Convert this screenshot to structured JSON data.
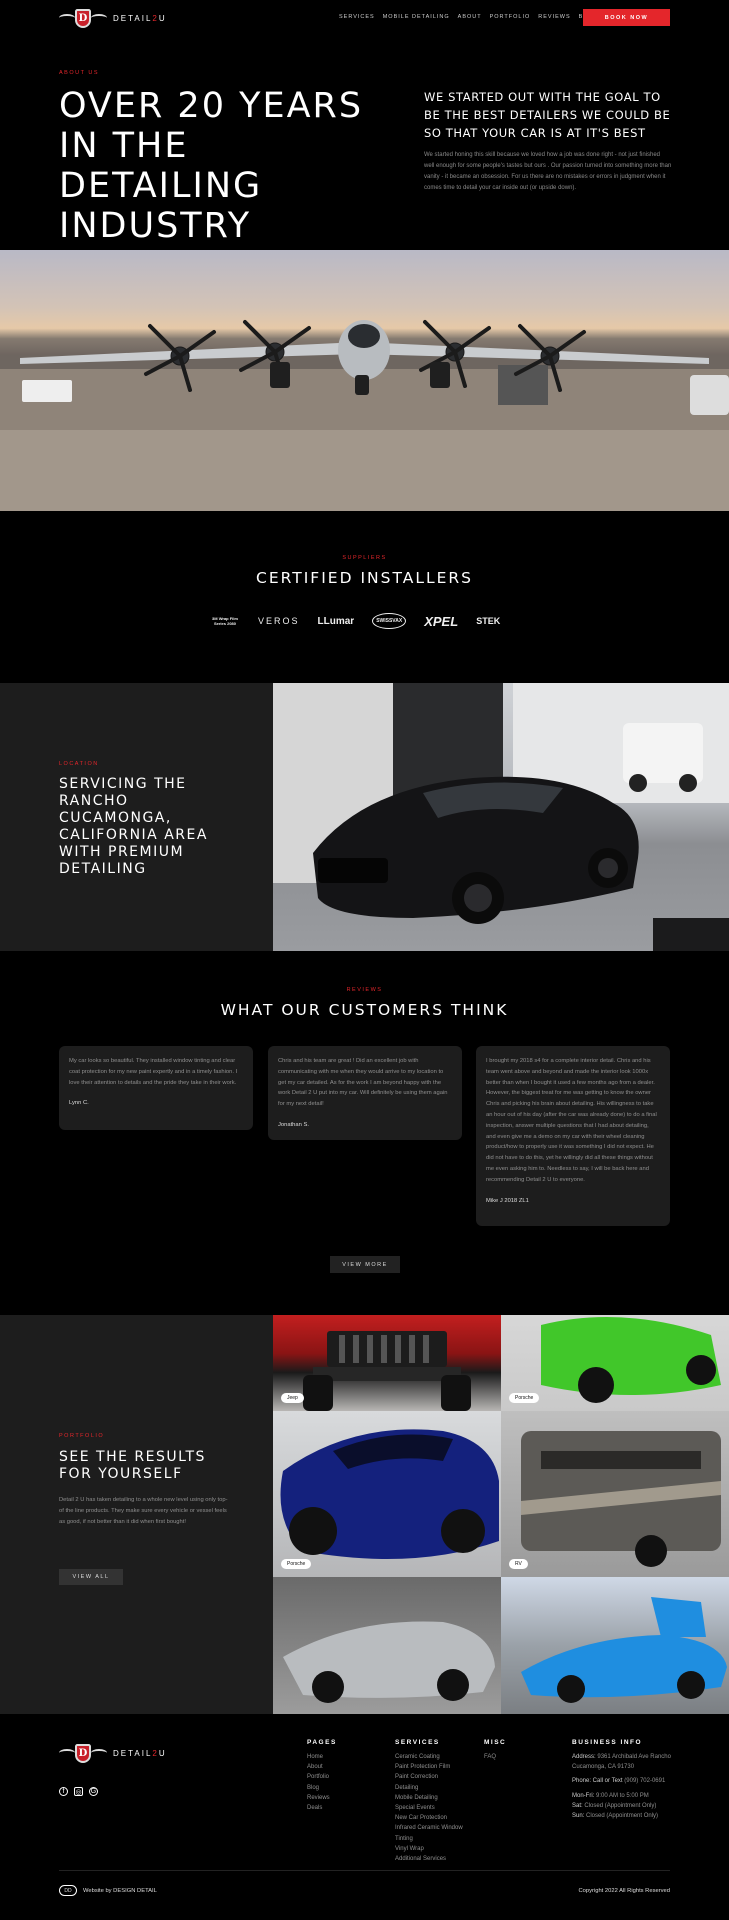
{
  "header": {
    "logo_text_a": "DETAIL",
    "logo_text_b": "2",
    "logo_text_c": "U",
    "logo_letter": "D",
    "nav": [
      "SERVICES",
      "MOBILE DETAILING",
      "ABOUT",
      "PORTFOLIO",
      "REVIEWS",
      "BLOG"
    ],
    "book_label": "BOOK NOW"
  },
  "about": {
    "eyebrow": "ABOUT US",
    "title": "OVER 20 YEARS IN THE DETAILING INDUSTRY",
    "subtitle": "WE STARTED OUT WITH THE GOAL TO BE THE BEST DETAILERS WE COULD BE SO THAT YOUR CAR IS AT IT'S BEST",
    "body": "We started honing this skill because we loved how a job was done right - not just finished well enough for some people's tastes but ours . Our passion turned into something more than vanity - it became an obsession. For us there are no mistakes or errors in judgment when it comes time to detail your car inside out (or upside down)."
  },
  "suppliers": {
    "eyebrow": "SUPPLIERS",
    "title": "CERTIFIED INSTALLERS",
    "logos": [
      "3M Wrap Film Series 2080",
      "VEROS",
      "LLumar",
      "SWISSVAX",
      "XPEL",
      "STEK"
    ]
  },
  "location": {
    "eyebrow": "LOCATION",
    "title": "SERVICING THE RANCHO CUCAMONGA, CALIFORNIA AREA WITH PREMIUM DETAILING"
  },
  "reviews": {
    "eyebrow": "REVIEWS",
    "title": "WHAT OUR CUSTOMERS THINK",
    "items": [
      {
        "text": "My car looks so beautiful. They installed window tinting and clear coat protection for my new paint expertly and in a timely fashion. I love their attention to details and the pride they take in their work.",
        "author": "Lynn C."
      },
      {
        "text": "Chris and his team are great ! Did an excellent job with communicating with me when they would arrive to my location to get my car detailed. As for the work I am beyond happy with the work Detail 2 U put into my car. Will definitely be using them again for my next detail!",
        "author": "Jonathan S."
      },
      {
        "text": "I brought my 2018 s4 for a complete interior detail. Chris and his team went above and beyond and made the interior look 1000x better than when I bought it used a few months ago from a dealer. However, the biggest treat for me was getting to know the owner Chris and picking his brain about detailing. His willingness to take an hour out of his day (after the car was already done) to do a final inspection, answer multiple questions that I had about detailing, and even give me a demo on my car with their wheel cleaning product/how to properly use it was something I did not expect. He did not have to do this, yet he willingly did all these things without me even asking him to. Needless to say, I will be back here and recommending Detail 2 U to everyone.",
        "author": "Mike J  2018 ZL1"
      }
    ],
    "view_more": "VIEW MORE"
  },
  "portfolio": {
    "eyebrow": "PORTFOLIO",
    "title": "SEE THE RESULTS FOR YOURSELF",
    "body": "Detail 2 U has taken detailing to a whole new level using only top-of the line products. They make sure every vehicle or vessel feels as good, if not better than it did when first bought!",
    "view_all": "VIEW ALL",
    "tags": [
      "Jeep",
      "Porsche",
      "Porsche",
      "RV"
    ]
  },
  "footer": {
    "pages_title": "PAGES",
    "pages": [
      "Home",
      "About",
      "Portfolio",
      "Blog",
      "Reviews",
      "Deals"
    ],
    "services_title": "SERVICES",
    "services": [
      "Ceramic Coating",
      "Paint Protection Film",
      "Paint Correction",
      "Detailing",
      "Mobile Detailing",
      "Special Events",
      "New Car Protection",
      "Infrared Ceramic Window",
      "Tinting",
      "Vinyl Wrap",
      "Additional Services"
    ],
    "misc_title": "MISC",
    "misc": [
      "FAQ"
    ],
    "info_title": "BUSINESS INFO",
    "address_label": "Address:",
    "address": "9361 Archibald Ave Rancho Cucamonga, CA 91730",
    "phone_label": "Phone: Call or Text",
    "phone": "(909) 702-0691",
    "hours": [
      {
        "label": "Mon-Fri:",
        "value": "9:00 AM to 5:00 PM"
      },
      {
        "label": "Sat:",
        "value": "Closed (Appointment Only)"
      },
      {
        "label": "Sun:",
        "value": "Closed (Appointment Only)"
      }
    ],
    "credit_mark": "DD",
    "credit": "Website by DESIGN DETAIL",
    "copyright": "Copyright 2022 All Rights Reserved"
  },
  "colors": {
    "accent": "#e4262b",
    "panel": "#1d1d1d",
    "bg": "#000000"
  }
}
